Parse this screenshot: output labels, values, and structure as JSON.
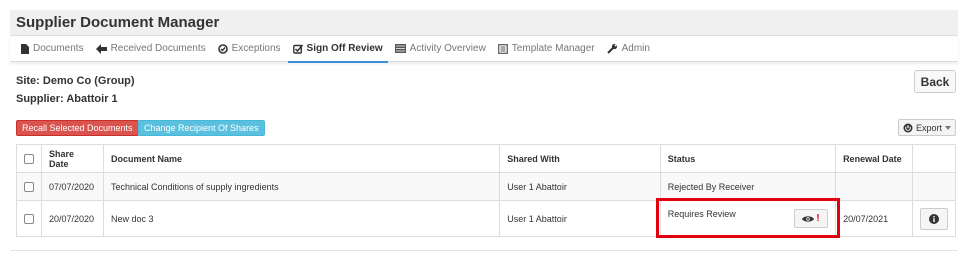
{
  "app": {
    "title": "Supplier Document Manager"
  },
  "tabs": [
    {
      "label": "Documents",
      "icon": "file-icon",
      "active": false
    },
    {
      "label": "Received Documents",
      "icon": "arrow-left-icon",
      "active": false
    },
    {
      "label": "Exceptions",
      "icon": "check-circle-icon",
      "active": false
    },
    {
      "label": "Sign Off Review",
      "icon": "checkbox-icon",
      "active": true
    },
    {
      "label": "Activity Overview",
      "icon": "list-icon",
      "active": false
    },
    {
      "label": "Template Manager",
      "icon": "template-icon",
      "active": false
    },
    {
      "label": "Admin",
      "icon": "wrench-icon",
      "active": false
    }
  ],
  "site": {
    "site_line": "Site: Demo Co (Group)",
    "supplier_line": "Supplier: Abattoir 1"
  },
  "actions": {
    "back": "Back",
    "recall": "Recall Selected Documents",
    "change_recipient": "Change Recipient Of Shares",
    "export": "Export"
  },
  "table": {
    "columns": [
      "Share Date",
      "Document Name",
      "Shared With",
      "Status",
      "Renewal Date"
    ],
    "rows": [
      {
        "share_date": "07/07/2020",
        "document_name": "Technical Conditions of supply ingredients",
        "shared_with": "User 1 Abattoir",
        "status": "Rejected By Receiver",
        "renewal_date": ""
      },
      {
        "share_date": "20/07/2020",
        "document_name": "New doc 3",
        "shared_with": "User 1 Abattoir",
        "status": "Requires Review",
        "renewal_date": "20/07/2021"
      }
    ]
  },
  "colors": {
    "accent": "#3a8fd6",
    "danger": "#d9534f",
    "info": "#5bc0de",
    "highlight": "#e3000f"
  }
}
